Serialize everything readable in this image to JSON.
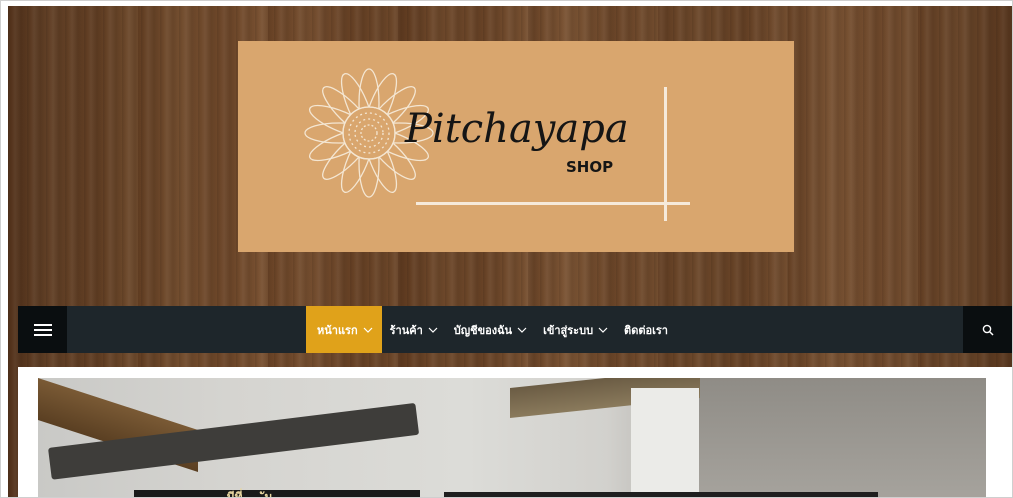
{
  "site": {
    "logo_title": "Pitchayapa",
    "logo_subtitle": "SHOP"
  },
  "nav": {
    "menu_icon": "hamburger-icon",
    "search_icon": "search-icon",
    "items": [
      {
        "label": "หน้าแรก",
        "active": true,
        "has_dropdown": true
      },
      {
        "label": "ร้านค้า",
        "active": false,
        "has_dropdown": true
      },
      {
        "label": "บัญชีของฉัน",
        "active": false,
        "has_dropdown": true
      },
      {
        "label": "เข้าสู่ระบบ",
        "active": false,
        "has_dropdown": true
      },
      {
        "label": "ติดต่อเรา",
        "active": false,
        "has_dropdown": false
      }
    ]
  },
  "hero": {
    "caption_partial": "...มีที่ ... ัน"
  },
  "colors": {
    "accent": "#e0a21a",
    "nav_bg": "#1e262b",
    "logo_bg": "#d9a66e"
  }
}
